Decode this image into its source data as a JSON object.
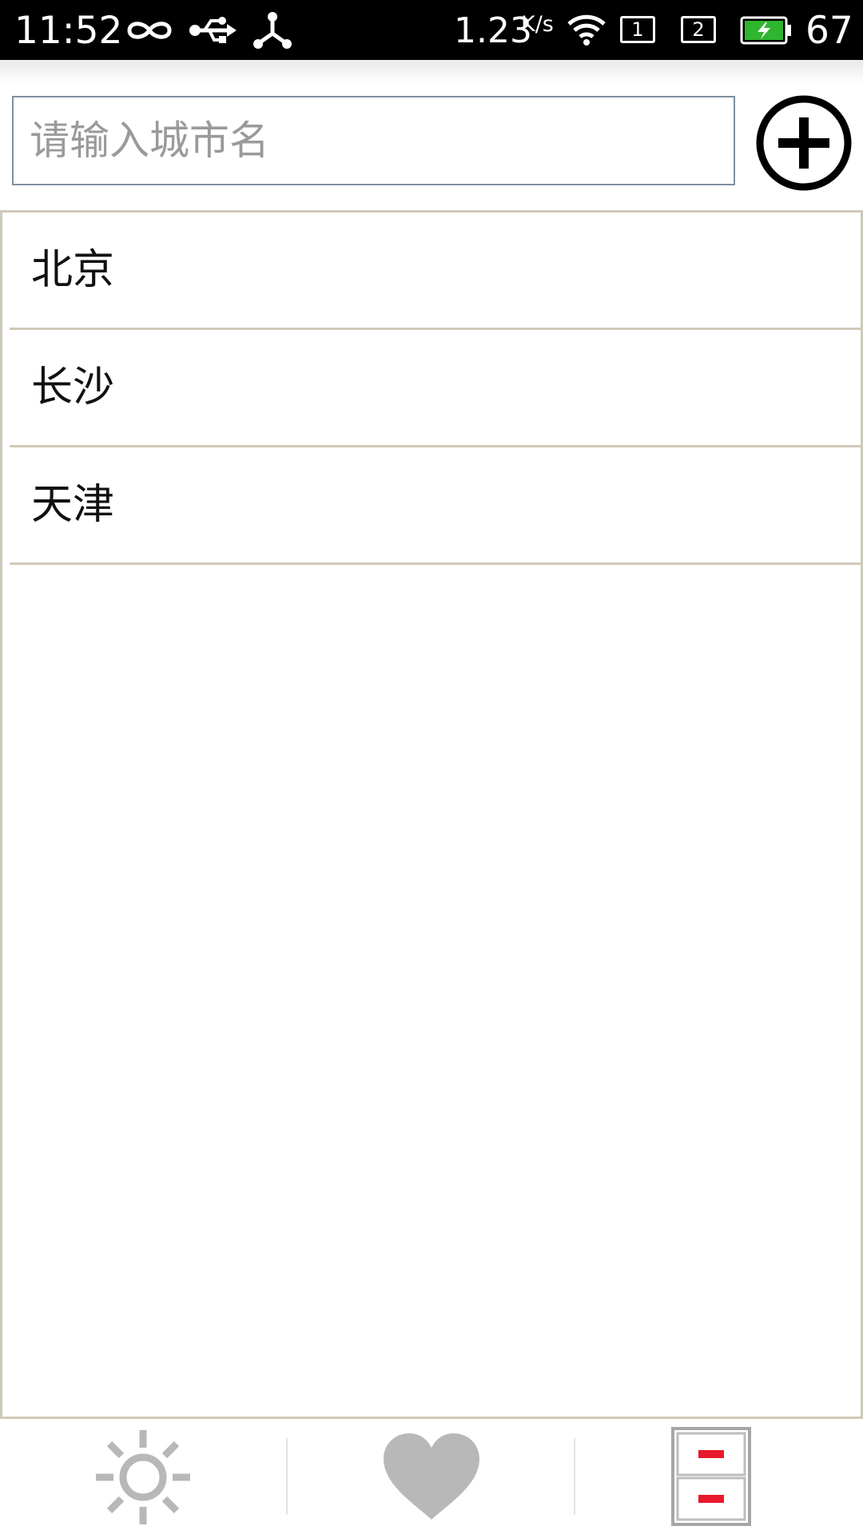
{
  "status_bar": {
    "time": "11:52",
    "network_speed": "1.23",
    "speed_unit": "K/s",
    "sim1": "1",
    "sim2": "2",
    "battery_level": "67",
    "icons": [
      "infinity-icon",
      "usb-icon",
      "share-hub-icon",
      "wifi-icon",
      "sim1-icon",
      "sim2-icon",
      "battery-charging-icon"
    ]
  },
  "search": {
    "placeholder": "请输入城市名",
    "value": "",
    "add_icon": "plus-circle-icon"
  },
  "cities": [
    {
      "name": "北京"
    },
    {
      "name": "长沙"
    },
    {
      "name": "天津"
    }
  ],
  "tabs": [
    {
      "icon": "sun-icon",
      "selected": false
    },
    {
      "icon": "heart-icon",
      "selected": false
    },
    {
      "icon": "city-manage-icon",
      "selected": true
    }
  ],
  "colors": {
    "list_border": "#cfc9b8",
    "input_border": "#7f8fa0",
    "tab_icon": "#b8b8b8",
    "accent_red": "#e8192c",
    "battery_green": "#2fb52f"
  }
}
